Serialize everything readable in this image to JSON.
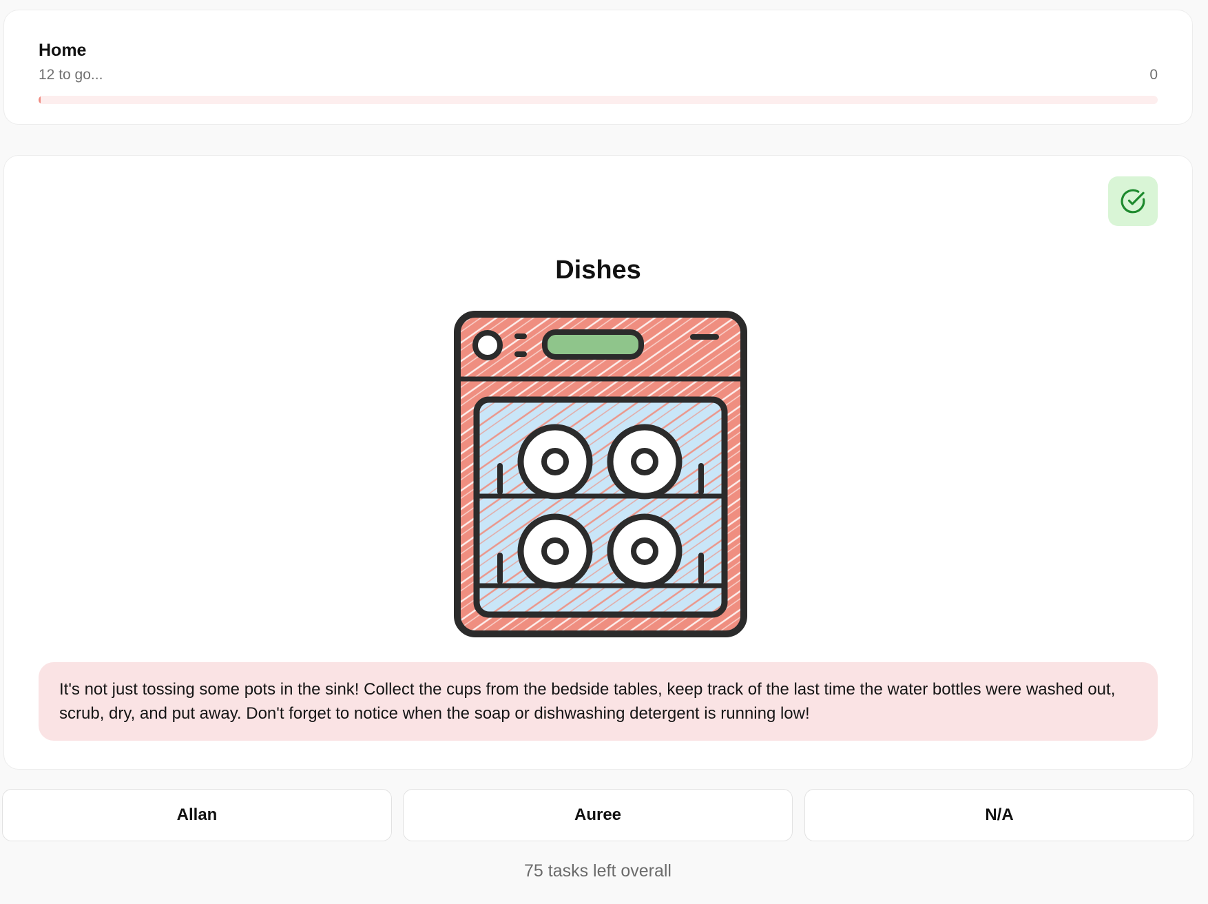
{
  "progress": {
    "title": "Home",
    "subtitle": "12 to go...",
    "count": "0",
    "fraction": 0.002,
    "track_color": "#fdeeee",
    "fill_color": "#f08a80"
  },
  "task": {
    "title": "Dishes",
    "illustration_icon": "dishwasher-icon",
    "complete_icon": "check-circle-icon",
    "description": "It's not just tossing some pots in the sink! Collect the cups from the bedside tables, keep track of the last time the water bottles were washed out, scrub, dry, and put away. Don't forget to notice when the soap or dishwashing detergent is running low!"
  },
  "assignees": [
    {
      "label": "Allan"
    },
    {
      "label": "Auree"
    },
    {
      "label": "N/A"
    }
  ],
  "footer": {
    "remaining": "75 tasks left overall"
  },
  "colors": {
    "accent_green": "#1e8a2e",
    "done_bg": "#d9f5d6",
    "description_bg": "#fae3e4",
    "dishwasher_body": "#ef8e80",
    "dishwasher_window": "#c9e6f8",
    "dishwasher_display": "#8fc58b"
  }
}
